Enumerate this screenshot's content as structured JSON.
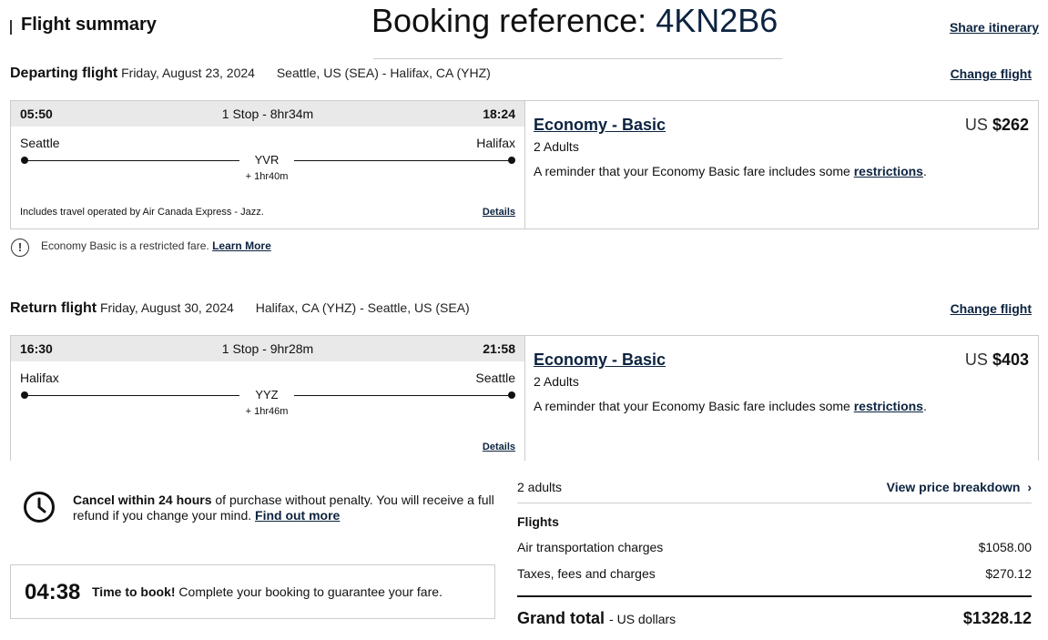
{
  "header": {
    "title": "Flight summary",
    "booking_label": "Booking reference:",
    "booking_code": "4KN2B6",
    "share": "Share itinerary"
  },
  "departing": {
    "label": "Departing flight",
    "date": "Friday, August 23, 2024",
    "route": "Seattle, US (SEA) - Halifax, CA (YHZ)",
    "change": "Change flight",
    "dep_time": "05:50",
    "stops": "1 Stop - 8hr34m",
    "arr_time": "18:24",
    "origin": "Seattle",
    "destination": "Halifax",
    "via": "YVR",
    "layover": "+ 1hr40m",
    "operated": "Includes travel operated by Air Canada Express - Jazz.",
    "details": "Details",
    "fare": "Economy - Basic",
    "currency": "US",
    "price": "$262",
    "pax": "2 Adults",
    "reminder": "A reminder that your Economy Basic fare includes some",
    "restrictions": "restrictions"
  },
  "note": {
    "text": "Economy Basic is a restricted fare.",
    "link": "Learn More"
  },
  "return": {
    "label": "Return flight",
    "date": "Friday, August 30, 2024",
    "route": "Halifax, CA (YHZ) - Seattle, US (SEA)",
    "change": "Change flight",
    "dep_time": "16:30",
    "stops": "1 Stop - 9hr28m",
    "arr_time": "21:58",
    "origin": "Halifax",
    "destination": "Seattle",
    "via": "YYZ",
    "layover": "+ 1hr46m",
    "details": "Details",
    "fare": "Economy - Basic",
    "currency": "US",
    "price": "$403",
    "pax": "2 Adults",
    "reminder": "A reminder that your Economy Basic fare includes some",
    "restrictions": "restrictions"
  },
  "cancel": {
    "bold": "Cancel within 24 hours",
    "text": "of purchase without penalty. You will receive a full refund if you change your mind.",
    "link": "Find out more"
  },
  "timer": {
    "value": "04:38",
    "bold": "Time to book!",
    "text": "Complete your booking to guarantee your fare."
  },
  "summary": {
    "adults": "2 adults",
    "breakdown": "View price breakdown",
    "flights": "Flights",
    "air_label": "Air transportation charges",
    "air_value": "$1058.00",
    "tax_label": "Taxes, fees and charges",
    "tax_value": "$270.12",
    "grand_label": "Grand total",
    "grand_sub": "- US dollars",
    "grand_value": "$1328.12"
  },
  "colors": {
    "brand": "#0c2340",
    "bar": "#e9e9e9",
    "border": "#cccccc"
  }
}
